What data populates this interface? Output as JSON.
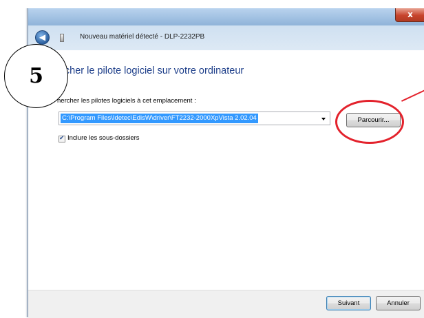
{
  "window": {
    "title": "Nouveau matériel détecté - DLP-2232PB",
    "close_label": "x",
    "back_label": "◀"
  },
  "main": {
    "heading": "ercher le pilote logiciel sur votre ordinateur",
    "path_label": "hercher les pilotes logiciels à cet emplacement :",
    "path_value": "C:\\Program Files\\Idetec\\EdisW\\driver\\FT2232-2000XpVista 2.02.04",
    "browse_label": "Parcourir...",
    "include_subfolders_label": "Inclure les sous-dossiers",
    "include_subfolders_checked": true
  },
  "footer": {
    "next_label": "Suivant",
    "cancel_label": "Annuler"
  },
  "annotation": {
    "step_number": "5",
    "highlight_color": "#e3222c"
  },
  "icons": {
    "back": "back-arrow-icon",
    "device": "hardware-device-icon",
    "dropdown": "chevron-down-icon",
    "check": "checkmark-icon"
  }
}
